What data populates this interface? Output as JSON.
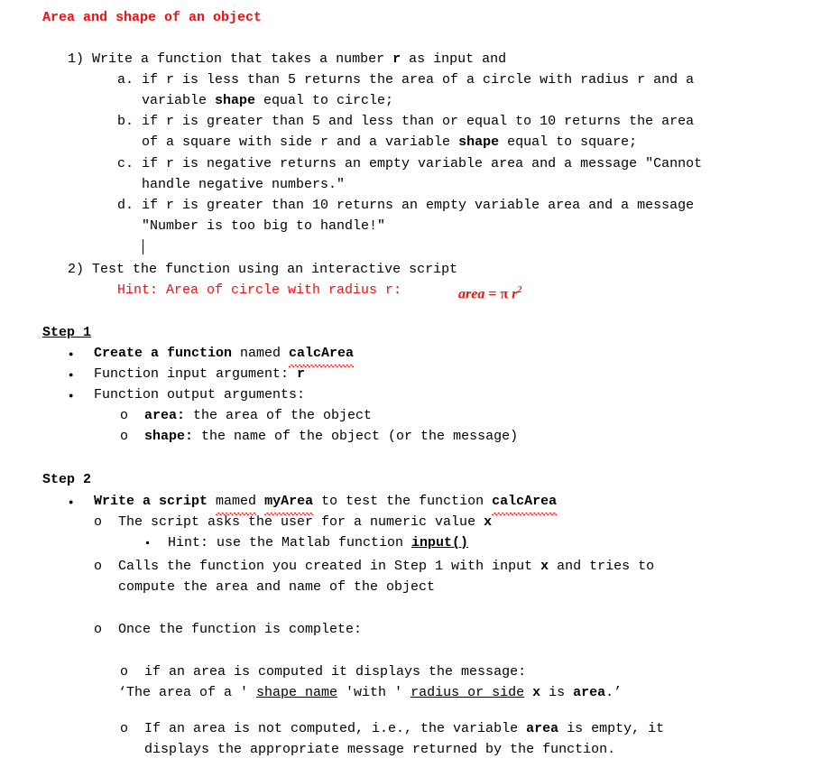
{
  "document": {
    "title": "Area and shape of an object",
    "title_color": "#ee1111"
  },
  "task_list": {
    "item1": {
      "marker": "1)",
      "text": "Write a function that takes a number ",
      "bold_var": "r",
      "text_after": " as input and"
    },
    "subitems": [
      {
        "marker": "a.",
        "line1_pre": "if r is less than 5 returns the area of a circle with radius r and a",
        "line2_pre": "variable ",
        "line2_bold": "shape",
        "line2_post": " equal to circle;"
      },
      {
        "marker": "b.",
        "line1_pre": "if r is greater than 5 and less than or equal to 10 returns the area",
        "line2_pre": "of a square with side r and a variable ",
        "line2_bold": "shape",
        "line2_post": " equal to square;"
      },
      {
        "marker": "c.",
        "line1_pre": "if r is negative returns an empty variable area and a message \"Cannot",
        "line2_pre": "handle negative numbers.\"",
        "line2_bold": "",
        "line2_post": ""
      },
      {
        "marker": "d.",
        "line1_pre": "if r is greater than 10 returns an empty variable area and a message",
        "line2_pre": "\"Number is too big to handle!\"",
        "line2_bold": "",
        "line2_post": ""
      }
    ],
    "item2": {
      "marker": "2)",
      "text": "Test the function using an interactive script"
    },
    "hint": {
      "text": "Hint: Area of circle with radius r:",
      "formula_lhs": "area",
      "formula_eq": " = ",
      "formula_pi": "π",
      "formula_var": " r",
      "formula_exp": "2"
    }
  },
  "step1": {
    "heading": "Step 1",
    "bullets": [
      {
        "bold_lead": "Create a function",
        "mid": " named ",
        "spell_word": "calcArea"
      },
      {
        "plain": "Function input argument: ",
        "bold_tail": "r"
      },
      {
        "plain": "Function output arguments:",
        "bold_tail": ""
      }
    ],
    "subbullets": [
      {
        "bold_term": "area:",
        "rest": " the area of the object"
      },
      {
        "bold_term": "shape:",
        "rest": " the name of the object (or the message)"
      }
    ]
  },
  "step2": {
    "heading": "Step 2",
    "bullet_main": {
      "bold_lead": "Write a script ",
      "spell_mamed": "mamed",
      "space1": " ",
      "spell_myarea": "myArea",
      "mid": " to test the function ",
      "spell_calcarea": "calcArea"
    },
    "sub1": {
      "text_pre": "The script asks the user for a numeric value ",
      "bold_var": "x"
    },
    "sub1_hint": {
      "text_pre": "Hint: use the Matlab function ",
      "bold_underline": "input()"
    },
    "sub2": {
      "line1_pre": "Calls the function you created in Step 1 with input ",
      "line1_bold": "x",
      "line1_post": " and tries to",
      "line2": "compute the area and name of the object"
    },
    "sub3": {
      "text": "Once the function is complete:"
    },
    "sub3_a": {
      "text": "if an area is computed it displays the message:",
      "msg_open": "‘The area of a ' ",
      "msg_underline1": "shape name",
      "msg_mid": " 'with ' ",
      "msg_underline2": "radius or side",
      "msg_space": " ",
      "msg_bold_x": "x",
      "msg_is": " is ",
      "msg_bold_area": "area",
      "msg_close": ".’"
    },
    "sub3_b": {
      "line1_pre": "If an area is not computed, i.e., the variable ",
      "line1_bold": "area",
      "line1_post": " is empty, it",
      "line2": "displays the appropriate message returned by the function."
    }
  }
}
